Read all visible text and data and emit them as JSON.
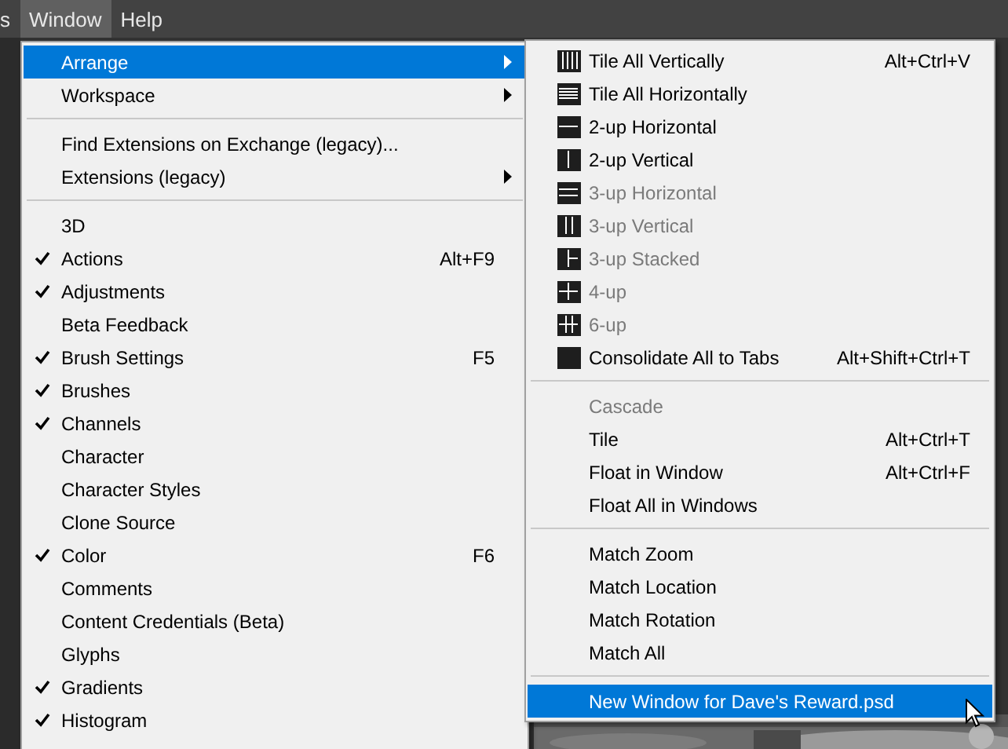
{
  "menubar": [
    {
      "label": "s",
      "selected": false
    },
    {
      "label": "Window",
      "selected": true
    },
    {
      "label": "Help",
      "selected": false
    }
  ],
  "window_menu": {
    "sections": [
      [
        {
          "label": "Arrange",
          "checked": false,
          "submenu": true,
          "selected": true
        },
        {
          "label": "Workspace",
          "checked": false,
          "submenu": true,
          "selected": false
        }
      ],
      [
        {
          "label": "Find Extensions on Exchange (legacy)...",
          "checked": false,
          "submenu": false,
          "selected": false
        },
        {
          "label": "Extensions (legacy)",
          "checked": false,
          "submenu": true,
          "selected": false
        }
      ],
      [
        {
          "label": "3D",
          "checked": false,
          "submenu": false,
          "selected": false
        },
        {
          "label": "Actions",
          "checked": true,
          "submenu": false,
          "selected": false,
          "shortcut": "Alt+F9"
        },
        {
          "label": "Adjustments",
          "checked": true,
          "submenu": false,
          "selected": false
        },
        {
          "label": "Beta Feedback",
          "checked": false,
          "submenu": false,
          "selected": false
        },
        {
          "label": "Brush Settings",
          "checked": true,
          "submenu": false,
          "selected": false,
          "shortcut": "F5"
        },
        {
          "label": "Brushes",
          "checked": true,
          "submenu": false,
          "selected": false
        },
        {
          "label": "Channels",
          "checked": true,
          "submenu": false,
          "selected": false
        },
        {
          "label": "Character",
          "checked": false,
          "submenu": false,
          "selected": false
        },
        {
          "label": "Character Styles",
          "checked": false,
          "submenu": false,
          "selected": false
        },
        {
          "label": "Clone Source",
          "checked": false,
          "submenu": false,
          "selected": false
        },
        {
          "label": "Color",
          "checked": true,
          "submenu": false,
          "selected": false,
          "shortcut": "F6"
        },
        {
          "label": "Comments",
          "checked": false,
          "submenu": false,
          "selected": false
        },
        {
          "label": "Content Credentials (Beta)",
          "checked": false,
          "submenu": false,
          "selected": false
        },
        {
          "label": "Glyphs",
          "checked": false,
          "submenu": false,
          "selected": false
        },
        {
          "label": "Gradients",
          "checked": true,
          "submenu": false,
          "selected": false
        },
        {
          "label": "Histogram",
          "checked": true,
          "submenu": false,
          "selected": false
        }
      ]
    ]
  },
  "arrange_submenu": {
    "sections": [
      [
        {
          "label": "Tile All Vertically",
          "kind": "cols4",
          "disabled": false,
          "selected": false,
          "shortcut": "Alt+Ctrl+V"
        },
        {
          "label": "Tile All Horizontally",
          "kind": "rows",
          "disabled": false,
          "selected": false
        },
        {
          "label": "2-up Horizontal",
          "kind": "h2",
          "disabled": false,
          "selected": false
        },
        {
          "label": "2-up Vertical",
          "kind": "v2",
          "disabled": false,
          "selected": false
        },
        {
          "label": "3-up Horizontal",
          "kind": "h3",
          "disabled": true,
          "selected": false
        },
        {
          "label": "3-up Vertical",
          "kind": "v3",
          "disabled": true,
          "selected": false
        },
        {
          "label": "3-up Stacked",
          "kind": "stacked",
          "disabled": true,
          "selected": false
        },
        {
          "label": "4-up",
          "kind": "up4",
          "disabled": true,
          "selected": false
        },
        {
          "label": "6-up",
          "kind": "up6",
          "disabled": true,
          "selected": false
        },
        {
          "label": "Consolidate All to Tabs",
          "kind": "single",
          "disabled": false,
          "selected": false,
          "shortcut": "Alt+Shift+Ctrl+T"
        }
      ],
      [
        {
          "label": "Cascade",
          "disabled": true,
          "selected": false
        },
        {
          "label": "Tile",
          "disabled": false,
          "selected": false,
          "shortcut": "Alt+Ctrl+T"
        },
        {
          "label": "Float in Window",
          "disabled": false,
          "selected": false,
          "shortcut": "Alt+Ctrl+F"
        },
        {
          "label": "Float All in Windows",
          "disabled": false,
          "selected": false
        }
      ],
      [
        {
          "label": "Match Zoom",
          "disabled": false,
          "selected": false
        },
        {
          "label": "Match Location",
          "disabled": false,
          "selected": false
        },
        {
          "label": "Match Rotation",
          "disabled": false,
          "selected": false
        },
        {
          "label": "Match All",
          "disabled": false,
          "selected": false
        }
      ],
      [
        {
          "label": "New Window for Dave's Reward.psd",
          "disabled": false,
          "selected": true
        }
      ]
    ]
  }
}
